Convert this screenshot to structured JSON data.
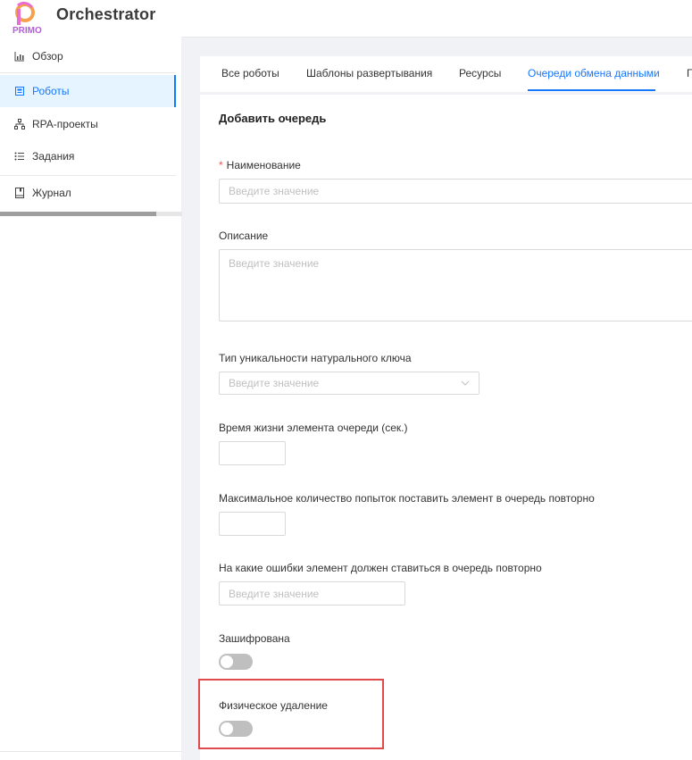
{
  "header": {
    "logo_text": "PRIMO",
    "app_title": "Orchestrator"
  },
  "sidebar": {
    "items": [
      {
        "label": "Обзор",
        "icon": "bar-chart-icon"
      },
      {
        "label": "Роботы",
        "icon": "robot-icon"
      },
      {
        "label": "RPA-проекты",
        "icon": "project-tree-icon"
      },
      {
        "label": "Задания",
        "icon": "list-icon"
      },
      {
        "label": "Журнал",
        "icon": "journal-icon"
      }
    ],
    "active_index": 1
  },
  "tabs": [
    {
      "label": "Все роботы"
    },
    {
      "label": "Шаблоны развертывания"
    },
    {
      "label": "Ресурсы"
    },
    {
      "label": "Очереди обмена данными"
    },
    {
      "label": "Гр"
    }
  ],
  "active_tab_index": 3,
  "form": {
    "title": "Добавить очередь",
    "name": {
      "label": "Наименование",
      "placeholder": "Введите значение",
      "required": true
    },
    "description": {
      "label": "Описание",
      "placeholder": "Введите значение"
    },
    "uniqueness_type": {
      "label": "Тип уникальности натурального ключа",
      "placeholder": "Введите значение"
    },
    "ttl": {
      "label": "Время жизни элемента очереди (сек.)",
      "value": ""
    },
    "max_retries": {
      "label": "Максимальное количество попыток поставить элемент в очередь повторно",
      "value": ""
    },
    "retry_errors": {
      "label": "На какие ошибки элемент должен ставиться в очередь повторно",
      "placeholder": "Введите значение"
    },
    "encrypted": {
      "label": "Зашифрована",
      "on": false
    },
    "physical_delete": {
      "label": "Физическое удаление",
      "on": false
    }
  },
  "colors": {
    "accent": "#1677ff",
    "required": "#ff4d4f",
    "highlight": "#e04a4a",
    "logo_pink": "#e86fd0",
    "logo_orange": "#f6a04d"
  }
}
